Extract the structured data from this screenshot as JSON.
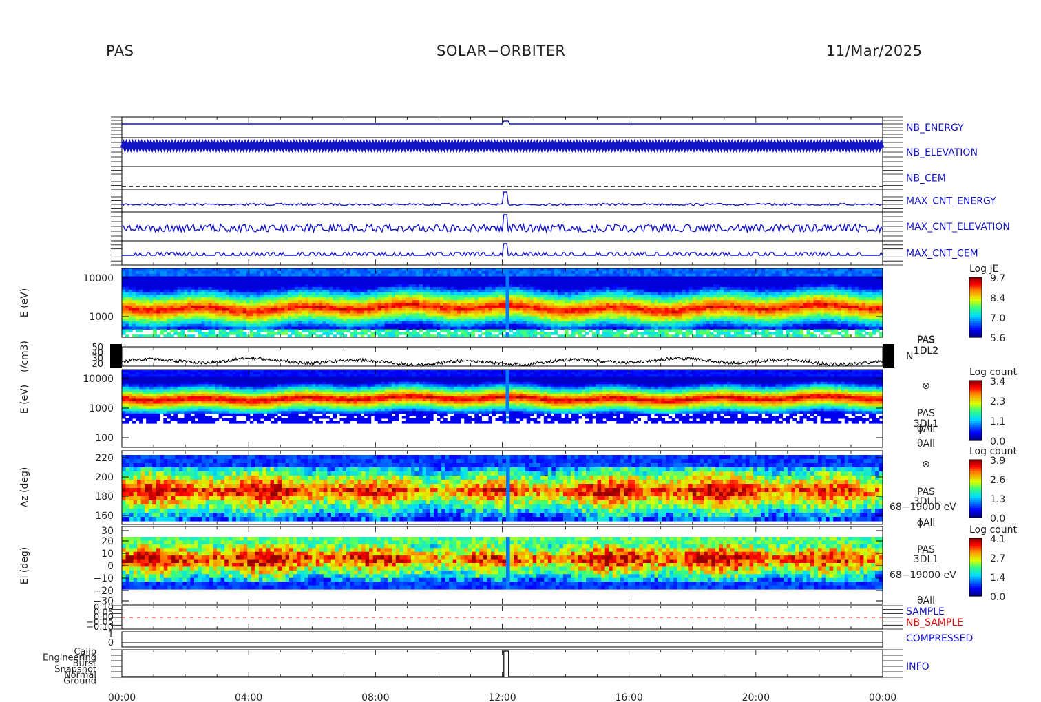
{
  "header": {
    "instrument": "PAS",
    "mission": "SOLAR−ORBITER",
    "date": "11/Mar/2025"
  },
  "chart_data": {
    "type": "heatmap",
    "x_ticks": [
      "00:00",
      "04:00",
      "08:00",
      "12:00",
      "16:00",
      "20:00",
      "00:00"
    ],
    "xlim_hours": [
      0,
      24
    ],
    "event_time_hours": 12.1,
    "hk_panels": [
      {
        "id": "nb-energy",
        "label": "NB_ENERGY",
        "color": "#1515c8"
      },
      {
        "id": "nb-elevation",
        "label": "NB_ELEVATION",
        "color": "#1515c8"
      },
      {
        "id": "nb-cem",
        "label": "NB_CEM",
        "color": "#1515c8"
      },
      {
        "id": "max-cnt-energy",
        "label": "MAX_CNT_ENERGY",
        "color": "#1515c8"
      },
      {
        "id": "max-cnt-elevation",
        "label": "MAX_CNT_ELEVATION",
        "color": "#1515c8"
      },
      {
        "id": "max-cnt-cem",
        "label": "MAX_CNT_CEM",
        "color": "#1515c8"
      }
    ],
    "spectrograms": [
      {
        "id": "energy-1dl2",
        "ylabel": "E (eV)",
        "scale": "log",
        "yticks": [
          "10000",
          "1000"
        ],
        "colorbar_title": "Log JE",
        "colorbar_ticks": [
          "9.7",
          "8.4",
          "7.0",
          "5.6"
        ],
        "right_labels": [
          "PAS",
          "1DL2"
        ]
      },
      {
        "id": "energy-3dl1",
        "ylabel": "E (eV)",
        "scale": "log",
        "yticks": [
          "10000",
          "1000",
          "100"
        ],
        "colorbar_title": "Log count",
        "colorbar_ticks": [
          "3.4",
          "2.3",
          "1.1",
          "0.0"
        ],
        "right_labels": [
          "⊗",
          "PAS",
          "3DL1",
          "ϕAll",
          "θAll"
        ]
      },
      {
        "id": "azimuth",
        "ylabel": "Az (deg)",
        "scale": "linear",
        "yticks": [
          "220",
          "200",
          "180",
          "160"
        ],
        "colorbar_title": "Log count",
        "colorbar_ticks": [
          "3.9",
          "2.6",
          "1.3",
          "0.0"
        ],
        "right_labels": [
          "⊗",
          "PAS",
          "3DL1",
          "68−19000 eV",
          "ϕAll"
        ]
      },
      {
        "id": "elevation",
        "ylabel": "El (deg)",
        "scale": "linear",
        "yticks": [
          "30",
          "20",
          "10",
          "0",
          "−10",
          "−20",
          "−30"
        ],
        "colorbar_title": "Log count",
        "colorbar_ticks": [
          "4.1",
          "2.7",
          "1.4",
          "0.0"
        ],
        "right_labels": [
          "PAS",
          "3DL1",
          "68−19000 eV",
          "θAll"
        ]
      }
    ],
    "density": {
      "ylabel": "(/cm3)",
      "yticks": [
        "50",
        "40",
        "30",
        "20"
      ],
      "ylim": [
        20,
        50
      ],
      "series_name": "N",
      "right_labels": [
        "PAS",
        "1DL2"
      ],
      "typical_value": 27
    },
    "sample_panel": {
      "series": [
        {
          "name": "SAMPLE",
          "color": "#1515c8"
        },
        {
          "name": "NB_SAMPLE",
          "color": "#e01010"
        }
      ],
      "yticks": [
        "0.10",
        "0.05",
        "0.00",
        "−0.05",
        "−0.10"
      ],
      "value": 0.0
    },
    "compressed_panel": {
      "name": "COMPRESSED",
      "yticks": [
        "1",
        "0"
      ],
      "value": 0
    },
    "info_panel": {
      "name": "INFO",
      "levels": [
        "Calib",
        "Engineering",
        "Burst",
        "Snapshot",
        "Normal",
        "Ground"
      ]
    }
  }
}
